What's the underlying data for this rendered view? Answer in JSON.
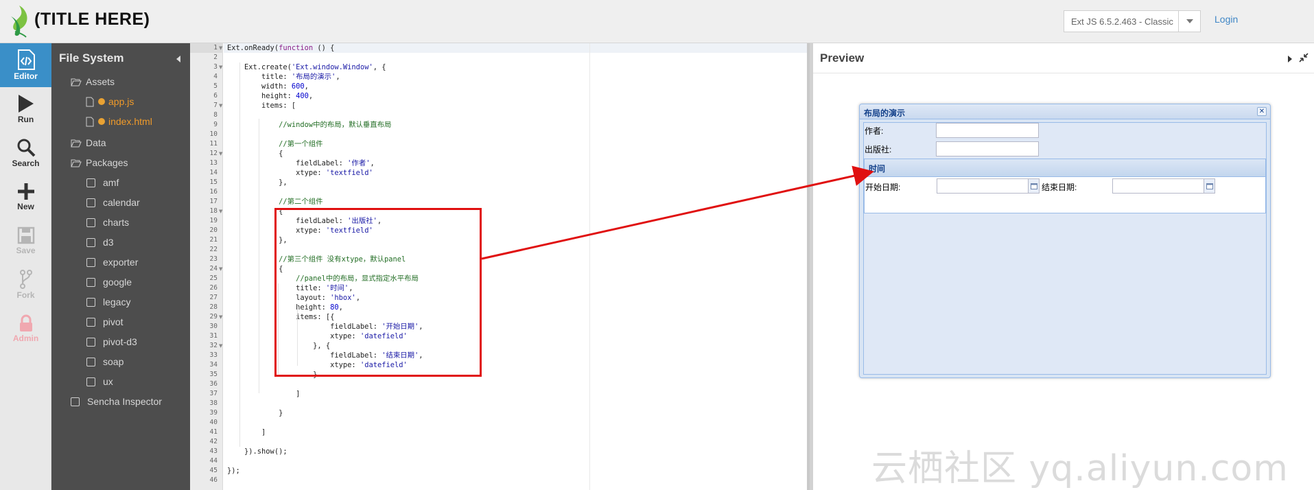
{
  "header": {
    "title": "(TITLE HERE)",
    "version": "Ext JS 6.5.2.463 - Classic",
    "login": "Login"
  },
  "toolbar": [
    {
      "label": "Editor",
      "icon": "code-file-icon",
      "state": "active"
    },
    {
      "label": "Run",
      "icon": "play-icon",
      "state": "normal"
    },
    {
      "label": "Search",
      "icon": "magnifier-icon",
      "state": "normal"
    },
    {
      "label": "New",
      "icon": "plus-icon",
      "state": "normal"
    },
    {
      "label": "Save",
      "icon": "floppy-icon",
      "state": "disabled"
    },
    {
      "label": "Fork",
      "icon": "branch-icon",
      "state": "disabled"
    },
    {
      "label": "Admin",
      "icon": "lock-icon",
      "state": "admin"
    }
  ],
  "filetree": {
    "title": "File System",
    "assets": "Assets",
    "files": [
      "app.js",
      "index.html"
    ],
    "data": "Data",
    "packages": "Packages",
    "package_items": [
      "amf",
      "calendar",
      "charts",
      "d3",
      "exporter",
      "google",
      "legacy",
      "pivot",
      "pivot-d3",
      "soap",
      "ux"
    ],
    "inspector": "Sencha Inspector"
  },
  "editor": {
    "lines": [
      {
        "t": [
          [
            "Ext.onReady(",
            ""
          ],
          [
            "function",
            "kw"
          ],
          [
            " () {",
            ""
          ]
        ]
      },
      {
        "t": []
      },
      {
        "t": [
          [
            "    Ext.create(",
            ""
          ],
          [
            "'Ext.window.Window'",
            "str"
          ],
          [
            ", {",
            ""
          ]
        ]
      },
      {
        "t": [
          [
            "        title: ",
            ""
          ],
          [
            "'布局的演示'",
            "str"
          ],
          [
            ",",
            ""
          ]
        ]
      },
      {
        "t": [
          [
            "        width: ",
            ""
          ],
          [
            "600",
            "num"
          ],
          [
            ",",
            ""
          ]
        ]
      },
      {
        "t": [
          [
            "        height: ",
            ""
          ],
          [
            "400",
            "num"
          ],
          [
            ",",
            ""
          ]
        ]
      },
      {
        "t": [
          [
            "        items: [",
            ""
          ]
        ]
      },
      {
        "t": []
      },
      {
        "t": [
          [
            "            //window中的布局，默认垂直布局",
            "cmt"
          ]
        ]
      },
      {
        "t": []
      },
      {
        "t": [
          [
            "            //第一个组件",
            "cmt"
          ]
        ]
      },
      {
        "t": [
          [
            "            {",
            ""
          ]
        ]
      },
      {
        "t": [
          [
            "                fieldLabel: ",
            ""
          ],
          [
            "'作者'",
            "str"
          ],
          [
            ",",
            ""
          ]
        ]
      },
      {
        "t": [
          [
            "                xtype: ",
            ""
          ],
          [
            "'textfield'",
            "str"
          ]
        ]
      },
      {
        "t": [
          [
            "            },",
            ""
          ]
        ]
      },
      {
        "t": []
      },
      {
        "t": [
          [
            "            //第二个组件",
            "cmt"
          ]
        ]
      },
      {
        "t": [
          [
            "            {",
            ""
          ]
        ]
      },
      {
        "t": [
          [
            "                fieldLabel: ",
            ""
          ],
          [
            "'出版社'",
            "str"
          ],
          [
            ",",
            ""
          ]
        ]
      },
      {
        "t": [
          [
            "                xtype: ",
            ""
          ],
          [
            "'textfield'",
            "str"
          ]
        ]
      },
      {
        "t": [
          [
            "            },",
            ""
          ]
        ]
      },
      {
        "t": []
      },
      {
        "t": [
          [
            "            //第三个组件 没有xtype，默认panel",
            "cmt"
          ]
        ]
      },
      {
        "t": [
          [
            "            {",
            ""
          ]
        ]
      },
      {
        "t": [
          [
            "                //panel中的布局，显式指定水平布局",
            "cmt"
          ]
        ]
      },
      {
        "t": [
          [
            "                title: ",
            ""
          ],
          [
            "'时间'",
            "str"
          ],
          [
            ",",
            ""
          ]
        ]
      },
      {
        "t": [
          [
            "                layout: ",
            ""
          ],
          [
            "'hbox'",
            "str"
          ],
          [
            ",",
            ""
          ]
        ]
      },
      {
        "t": [
          [
            "                height: ",
            ""
          ],
          [
            "80",
            "num"
          ],
          [
            ",",
            ""
          ]
        ]
      },
      {
        "t": [
          [
            "                items: [{",
            ""
          ]
        ]
      },
      {
        "t": [
          [
            "                        fieldLabel: ",
            ""
          ],
          [
            "'开始日期'",
            "str"
          ],
          [
            ",",
            ""
          ]
        ]
      },
      {
        "t": [
          [
            "                        xtype: ",
            ""
          ],
          [
            "'datefield'",
            "str"
          ]
        ]
      },
      {
        "t": [
          [
            "                    }, {",
            ""
          ]
        ]
      },
      {
        "t": [
          [
            "                        fieldLabel: ",
            ""
          ],
          [
            "'结束日期'",
            "str"
          ],
          [
            ",",
            ""
          ]
        ]
      },
      {
        "t": [
          [
            "                        xtype: ",
            ""
          ],
          [
            "'datefield'",
            "str"
          ]
        ]
      },
      {
        "t": [
          [
            "                    }",
            ""
          ]
        ]
      },
      {
        "t": []
      },
      {
        "t": [
          [
            "                ]",
            ""
          ]
        ]
      },
      {
        "t": []
      },
      {
        "t": [
          [
            "            }",
            ""
          ]
        ]
      },
      {
        "t": []
      },
      {
        "t": [
          [
            "        ]",
            ""
          ]
        ]
      },
      {
        "t": []
      },
      {
        "t": [
          [
            "    }).show();",
            ""
          ]
        ]
      },
      {
        "t": []
      },
      {
        "t": [
          [
            "});",
            ""
          ]
        ]
      },
      {
        "t": []
      }
    ],
    "fold_lines": [
      1,
      3,
      7,
      12,
      18,
      24,
      29,
      32
    ]
  },
  "preview": {
    "title": "Preview",
    "window_title": "布局的演示",
    "field1_label": "作者:",
    "field2_label": "出版社:",
    "panel_title": "时间",
    "date1_label": "开始日期:",
    "date2_label": "结束日期:"
  },
  "watermark": "云栖社区 yq.aliyun.com",
  "colors": {
    "accent": "#3a8fc8",
    "tree_bg": "#4d4d4d",
    "highlight": "#e01010",
    "ext_border": "#99bbe8",
    "ext_title": "#15428b"
  }
}
